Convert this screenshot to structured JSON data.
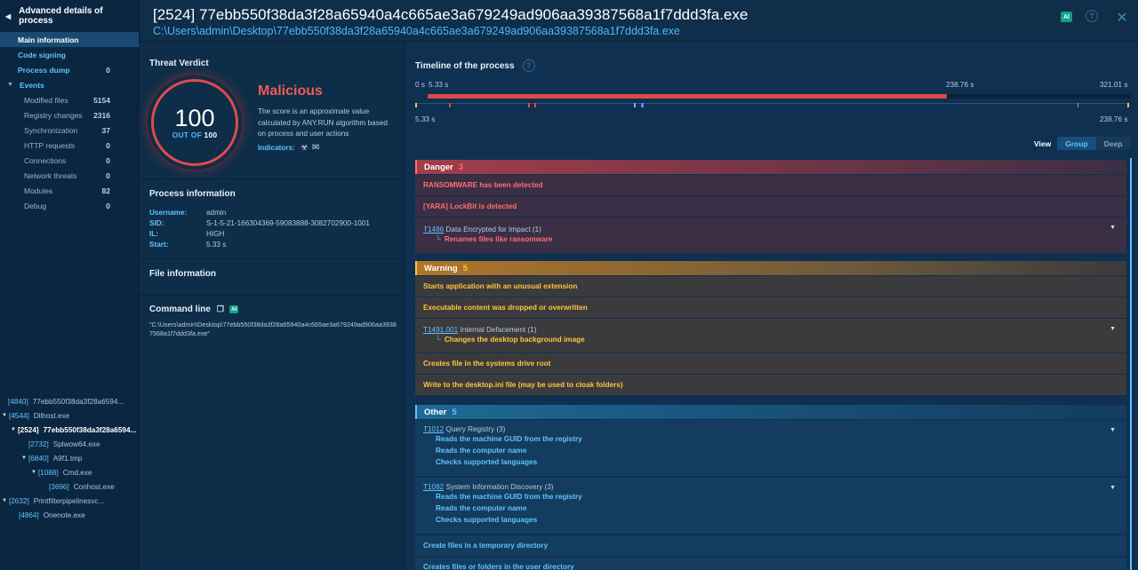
{
  "sidebar": {
    "header": "Advanced details of process",
    "items": [
      {
        "label": "Main information",
        "count": ""
      },
      {
        "label": "Code signing",
        "count": ""
      },
      {
        "label": "Process dump",
        "count": "0"
      }
    ],
    "events_label": "Events",
    "events": [
      {
        "label": "Modified files",
        "count": "5154"
      },
      {
        "label": "Registry changes",
        "count": "2316"
      },
      {
        "label": "Synchronization",
        "count": "37"
      },
      {
        "label": "HTTP requests",
        "count": "0"
      },
      {
        "label": "Connections",
        "count": "0"
      },
      {
        "label": "Network threats",
        "count": "0"
      },
      {
        "label": "Modules",
        "count": "82"
      },
      {
        "label": "Debug",
        "count": "0"
      }
    ],
    "tree": [
      {
        "pid": "[4840]",
        "name": "77ebb550f38da3f28a6594..."
      },
      {
        "pid": "[4544]",
        "name": "Dllhost.exe"
      },
      {
        "pid": "[2524]",
        "name": "77ebb550f38da3f28a6594..."
      },
      {
        "pid": "[2732]",
        "name": "Splwow64.exe"
      },
      {
        "pid": "[6840]",
        "name": "A9f1.tmp"
      },
      {
        "pid": "[1088]",
        "name": "Cmd.exe"
      },
      {
        "pid": "[3696]",
        "name": "Conhost.exe"
      },
      {
        "pid": "[2632]",
        "name": "Printfilterpipelinesvc..."
      },
      {
        "pid": "[4864]",
        "name": "Onenote.exe"
      }
    ]
  },
  "header": {
    "title": "[2524] 77ebb550f38da3f28a65940a4c665ae3a679249ad906aa39387568a1f7ddd3fa.exe",
    "path": "C:\\Users\\admin\\Desktop\\77ebb550f38da3f28a65940a4c665ae3a679249ad906aa39387568a1f7ddd3fa.exe",
    "ai_badge": "AI",
    "help": "?",
    "close": "✕"
  },
  "verdict": {
    "section_title": "Threat Verdict",
    "score": "100",
    "out_of_prefix": "OUT OF",
    "out_of_value": "100",
    "label": "Malicious",
    "description": "The score is an approximate value calculated by ANY.RUN algorithm based on process and user actions",
    "indicators_label": "Indicators:"
  },
  "process_info": {
    "section_title": "Process information",
    "fields": [
      {
        "key": "Username:",
        "value": "admin"
      },
      {
        "key": "SID:",
        "value": "S-1-5-21-166304369-59083888-3082702900-1001"
      },
      {
        "key": "IL:",
        "value": "HIGH"
      },
      {
        "key": "Start:",
        "value": "5.33 s"
      }
    ]
  },
  "file_info": {
    "section_title": "File information"
  },
  "command_line": {
    "section_title": "Command line",
    "ai": "AI",
    "value": "\"C:\\Users\\admin\\Desktop\\77ebb550f38da3f28a65940a4c665ae3a679249ad906aa39387568a1f7ddd3fa.exe\""
  },
  "timeline": {
    "title": "Timeline of the process",
    "start": "0 s",
    "proc_start": "5.33 s",
    "proc_end": "238.76 s",
    "total": "321.01 s",
    "range_start": "5.33 s",
    "range_end": "238.76 s",
    "bar_color": "#e04848"
  },
  "view": {
    "label": "View",
    "group": "Group",
    "deep": "Deep"
  },
  "groups": {
    "danger": {
      "label": "Danger",
      "count": "3",
      "rows": [
        {
          "main": "RANSOMWARE has been detected"
        },
        {
          "main": "[YARA] LockBit is detected"
        },
        {
          "tech": "T1486",
          "desc": "Data Encrypted for Impact (1)",
          "subs": [
            "Renames files like ransomware"
          ]
        }
      ]
    },
    "warning": {
      "label": "Warning",
      "count": "5",
      "rows": [
        {
          "main": "Starts application with an unusual extension"
        },
        {
          "main": "Executable content was dropped or overwritten"
        },
        {
          "tech": "T1491.001",
          "desc": "Internal Defacement (1)",
          "subs": [
            "Changes the desktop background image"
          ]
        },
        {
          "main": "Creates file in the systems drive root"
        },
        {
          "main": "Write to the desktop.ini file (may be used to cloak folders)"
        }
      ]
    },
    "other": {
      "label": "Other",
      "count": "5",
      "rows": [
        {
          "tech": "T1012",
          "desc": "Query Registry (3)",
          "subs": [
            "Reads the machine GUID from the registry",
            "Reads the computer name",
            "Checks supported languages"
          ]
        },
        {
          "tech": "T1082",
          "desc": "System Information Discovery (3)",
          "subs": [
            "Reads the machine GUID from the registry",
            "Reads the computer name",
            "Checks supported languages"
          ]
        },
        {
          "main": "Create files in a temporary directory"
        },
        {
          "main": "Creates files or folders in the user directory"
        }
      ]
    }
  },
  "colors": {
    "danger": "#ff6e6e",
    "warning": "#ffc542",
    "other": "#5fc3ff",
    "accent": "#4fb8ff"
  }
}
